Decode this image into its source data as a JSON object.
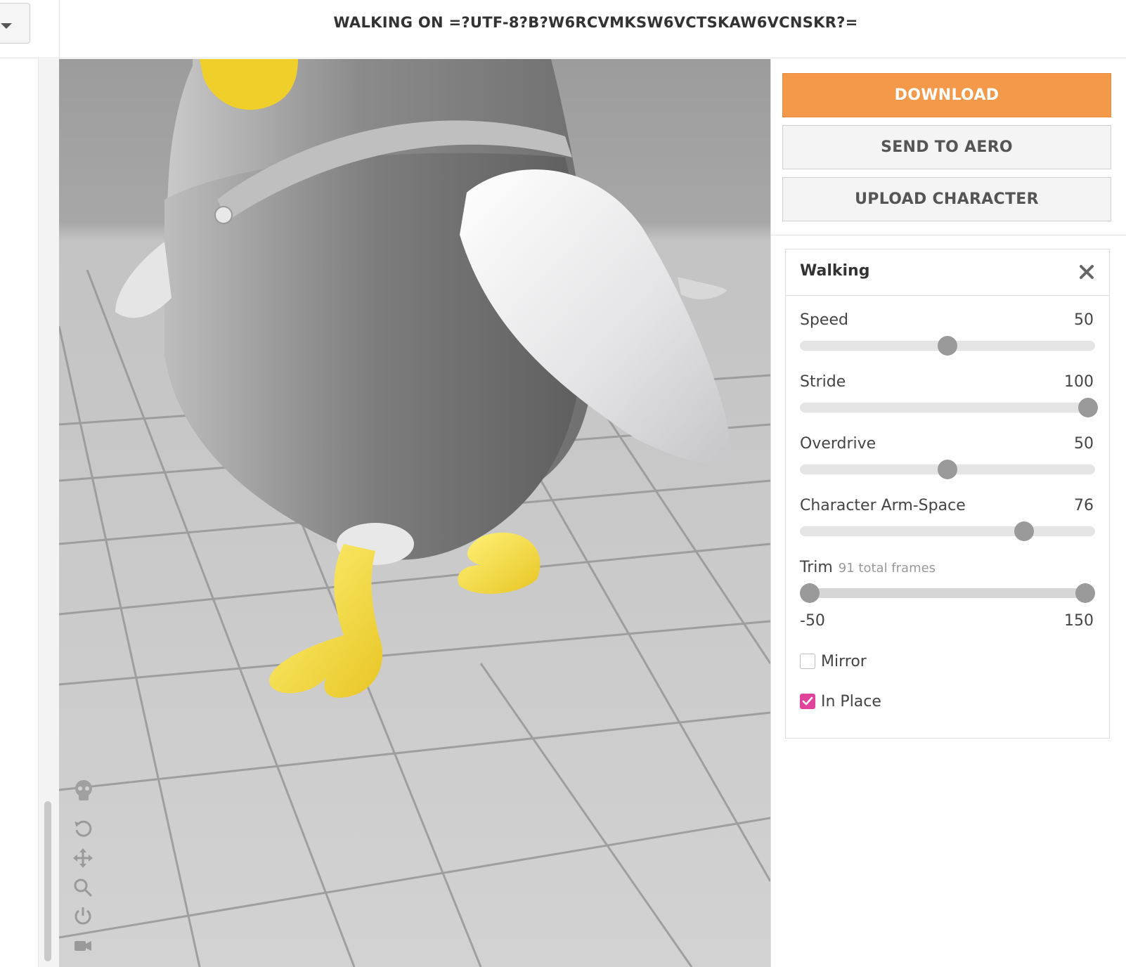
{
  "header": {
    "title": "WALKING ON =?UTF-8?B?W6RCVMKSW6VCTSKAW6VCNSKR?="
  },
  "left": {
    "dropdown_icon": "caret-down-icon"
  },
  "viewer_tools": [
    "skeleton-icon",
    "rotate-icon",
    "pan-icon",
    "zoom-icon",
    "power-icon",
    "camera-icon"
  ],
  "actions": {
    "download": "DOWNLOAD",
    "send_to_aero": "SEND TO AERO",
    "upload_character": "UPLOAD CHARACTER"
  },
  "settings": {
    "title": "Walking",
    "close_icon": "close-icon",
    "params": [
      {
        "label": "Speed",
        "value": 50,
        "min": 0,
        "max": 100
      },
      {
        "label": "Stride",
        "value": 100,
        "min": 0,
        "max": 100
      },
      {
        "label": "Overdrive",
        "value": 50,
        "min": 0,
        "max": 100
      },
      {
        "label": "Character Arm-Space",
        "value": 76,
        "min": 0,
        "max": 100
      }
    ],
    "trim": {
      "label": "Trim",
      "subtitle": "91 total frames",
      "min_label": "-50",
      "max_label": "150"
    },
    "mirror": {
      "label": "Mirror",
      "checked": false
    },
    "in_place": {
      "label": "In Place",
      "checked": true
    }
  },
  "colors": {
    "accent": "#f4994a",
    "checkbox": "#e0439a",
    "character_body": "#a9a9a9",
    "character_feet": "#f2d63a"
  }
}
